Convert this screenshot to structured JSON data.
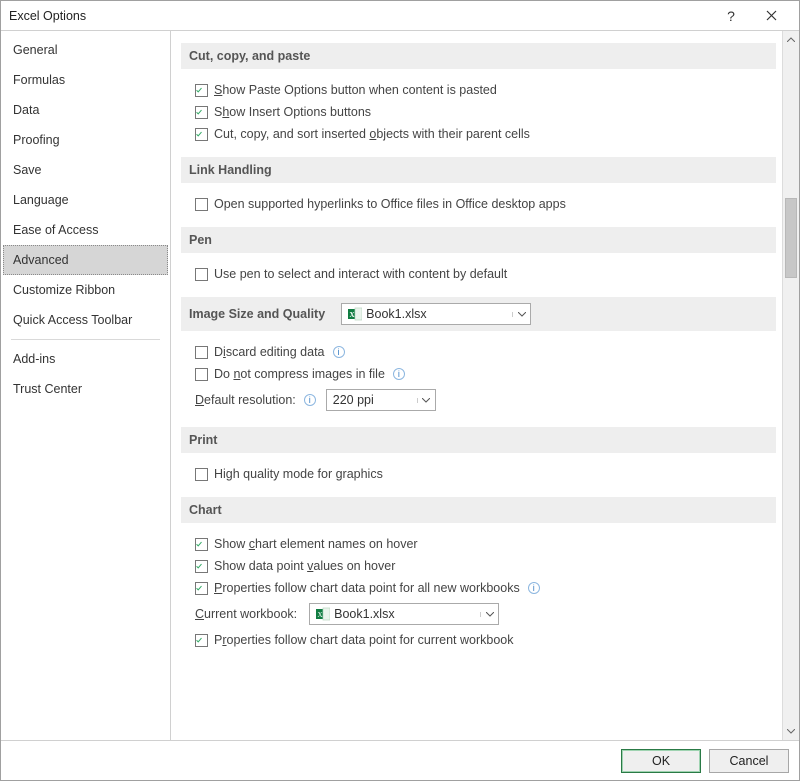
{
  "window": {
    "title": "Excel Options"
  },
  "sidebar": {
    "items": [
      "General",
      "Formulas",
      "Data",
      "Proofing",
      "Save",
      "Language",
      "Ease of Access",
      "Advanced",
      "Customize Ribbon",
      "Quick Access Toolbar",
      "Add-ins",
      "Trust Center"
    ],
    "selected": "Advanced"
  },
  "sections": {
    "cut": {
      "title": "Cut, copy, and paste",
      "opt1": {
        "text": "Show Paste Options button when content is pasted",
        "checked": true,
        "accel": "S"
      },
      "opt2": {
        "text": "Show Insert Options buttons",
        "checked": true,
        "accel": "h"
      },
      "opt3": {
        "text": "Cut, copy, and sort inserted objects with their parent cells",
        "checked": true,
        "accel": "o"
      }
    },
    "link": {
      "title": "Link Handling",
      "opt1": {
        "text": "Open supported hyperlinks to Office files in Office desktop apps",
        "checked": false
      }
    },
    "pen": {
      "title": "Pen",
      "opt1": {
        "text": "Use pen to select and interact with content by default",
        "checked": false
      }
    },
    "image": {
      "title": "Image Size and Quality",
      "target": "Book1.xlsx",
      "opt1": {
        "text": "Discard editing data",
        "checked": false,
        "accel": "i"
      },
      "opt2": {
        "text": "Do not compress images in file",
        "checked": false,
        "accel": "n"
      },
      "resLabel": "Default resolution:",
      "resAccel": "D",
      "resValue": "220 ppi"
    },
    "print": {
      "title": "Print",
      "opt1": {
        "text": "High quality mode for graphics",
        "checked": false
      }
    },
    "chart": {
      "title": "Chart",
      "opt1": {
        "text": "Show chart element names on hover",
        "checked": true,
        "accel": "c"
      },
      "opt2": {
        "text": "Show data point values on hover",
        "checked": true,
        "accel": "v"
      },
      "opt3": {
        "text": "Properties follow chart data point for all new workbooks",
        "checked": true,
        "accel": "P"
      },
      "wbLabel": "Current workbook:",
      "wbAccel": "C",
      "wbValue": "Book1.xlsx",
      "opt4": {
        "text": "Properties follow chart data point for current workbook",
        "checked": true,
        "accel": "r"
      }
    }
  },
  "footer": {
    "ok": "OK",
    "cancel": "Cancel"
  }
}
